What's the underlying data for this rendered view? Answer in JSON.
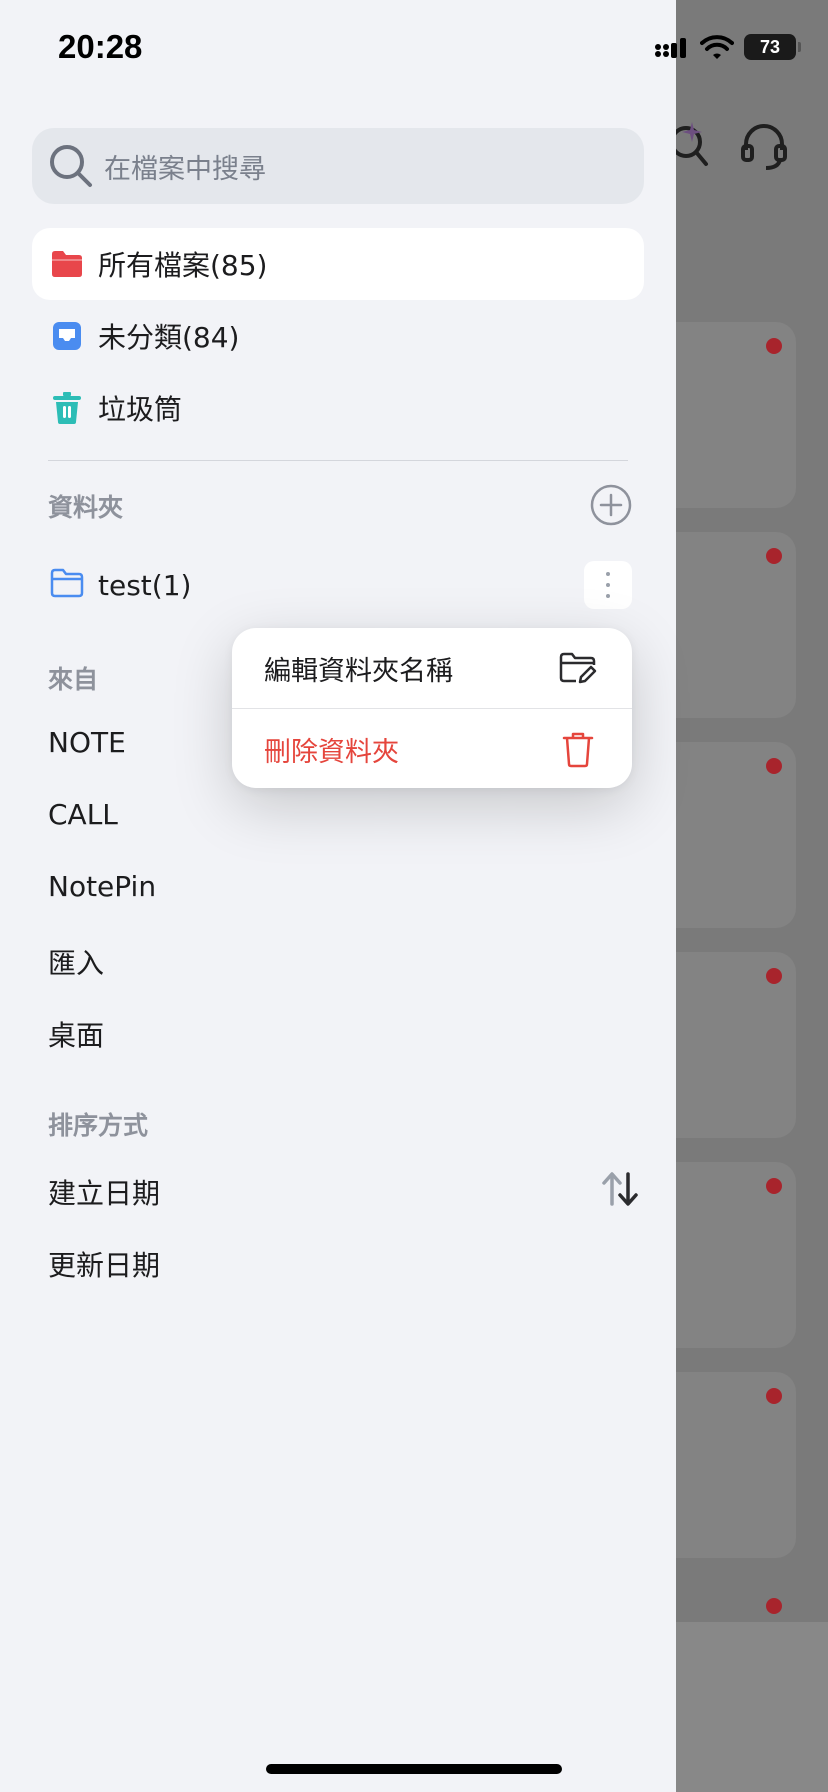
{
  "status": {
    "time": "20:28",
    "battery": "73"
  },
  "search": {
    "placeholder": "在檔案中搜尋"
  },
  "nav": [
    {
      "label": "所有檔案(85)",
      "icon": "folder-red-icon",
      "active": true
    },
    {
      "label": "未分類(84)",
      "icon": "inbox-icon",
      "active": false
    },
    {
      "label": "垃圾筒",
      "icon": "trash-icon",
      "active": false
    }
  ],
  "folders_section": {
    "title": "資料夾",
    "items": [
      {
        "label": "test(1)"
      }
    ]
  },
  "from_section": {
    "title": "來自",
    "items": [
      "NOTE",
      "CALL",
      "NotePin",
      "匯入",
      "桌面"
    ]
  },
  "sort_section": {
    "title": "排序方式",
    "items": [
      "建立日期",
      "更新日期"
    ]
  },
  "popup_menu": {
    "items": [
      {
        "label": "編輯資料夾名稱",
        "icon": "folder-edit-icon",
        "color": "#1c1c1e"
      },
      {
        "label": "刪除資料夾",
        "icon": "trash-icon",
        "color": "#e5453c"
      }
    ]
  },
  "colors": {
    "accent_red": "#e8464b",
    "accent_blue": "#4a8cf0",
    "accent_teal": "#2dbdb6",
    "danger": "#e5453c"
  }
}
